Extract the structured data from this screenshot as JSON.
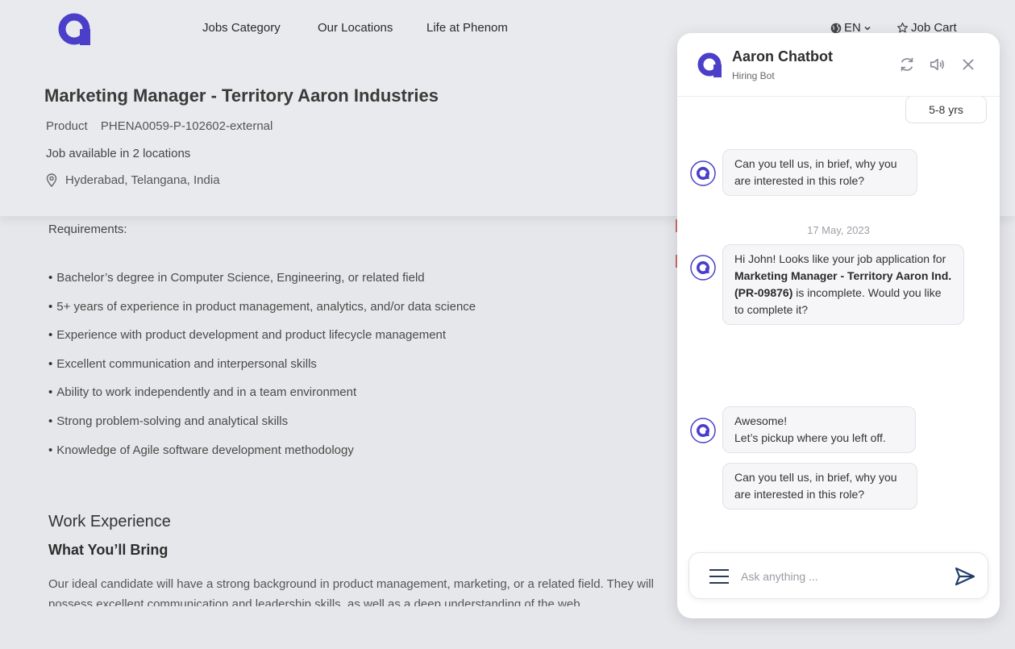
{
  "nav": {
    "items": [
      "Jobs Category",
      "Our Locations",
      "Life at Phenom"
    ],
    "lang": "EN",
    "cart": "Job Cart"
  },
  "job": {
    "title": "Marketing Manager - Territory Aaron Industries",
    "category": "Product",
    "code": "PHENA0059-P-102602-external",
    "availability": "Job available in 2 locations",
    "location": "Hyderabad, Telangana, India"
  },
  "content": {
    "requirements_title": "Requirements:",
    "requirements": [
      "Bachelor’s degree in Computer Science, Engineering, or related field",
      "5+ years of experience in product management, analytics, and/or data science",
      "Experience with product development and product lifecycle management",
      "Excellent communication and interpersonal skills",
      "Ability to work independently and in a team environment",
      "Strong problem-solving and analytical skills",
      "Knowledge of Agile software development methodology"
    ],
    "work_title": "Work Experience",
    "bring_title": "What You’ll Bring",
    "paragraph": "Our ideal candidate will have a strong background in product management, marketing, or a related field. They will possess excellent communication and leadership skills, as well as a deep understanding of the web"
  },
  "chat": {
    "name": "Aaron Chatbot",
    "subtitle": "Hiring Bot",
    "user_reply": "5-8 yrs",
    "msg1": "Can you tell us, in brief, why you are interested in this role?",
    "date": "17 May, 2023",
    "msg2_pre": "Hi John! Looks like your job application for ",
    "msg2_bold": "Marketing Manager - Territory Aaron Ind.(PR-09876)",
    "msg2_post": " is incomplete. Would you like to complete it?",
    "msg3_line1": "Awesome!",
    "msg3_line2": "Let’s pickup where you left off.",
    "msg4": "Can you tell us, in brief, why you are interested in this role?",
    "input_placeholder": "Ask anything ..."
  },
  "colors": {
    "brand": "#4b3fc9",
    "background": "#e6e7ea",
    "panel": "#ffffff"
  }
}
